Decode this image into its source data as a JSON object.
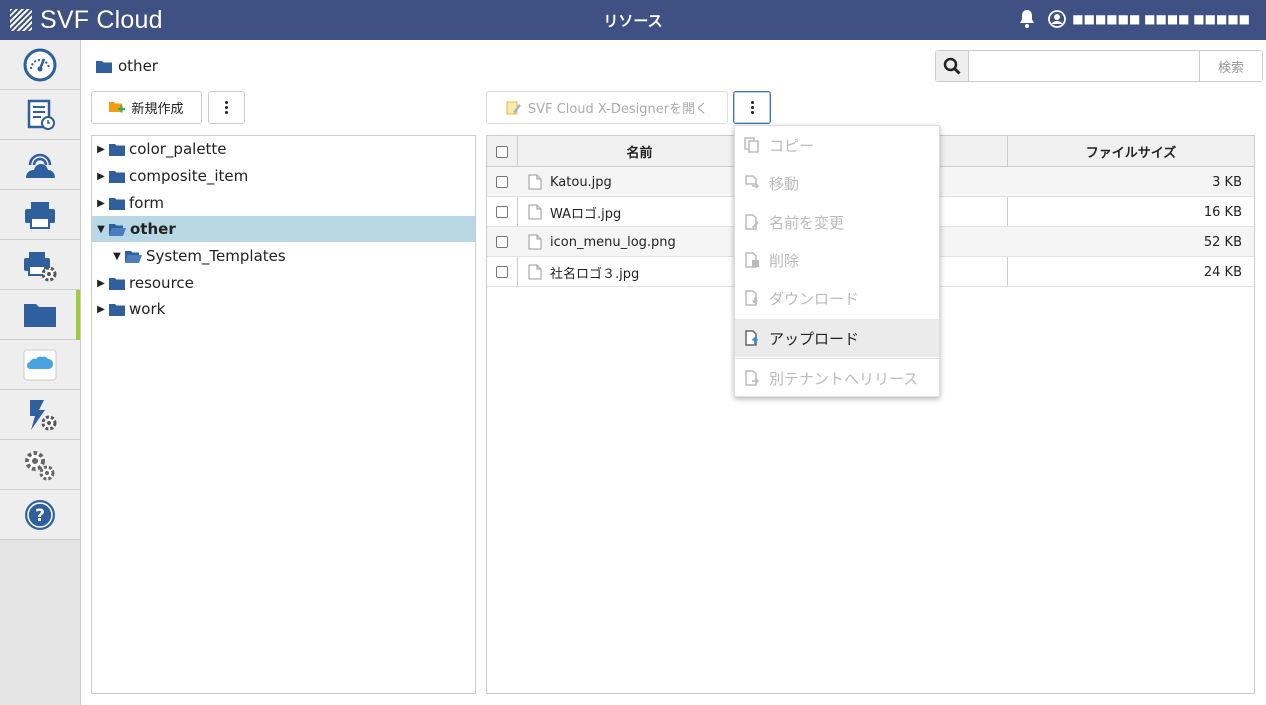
{
  "header": {
    "app_name": "SVF Cloud",
    "title": "リソース",
    "user_name": "■■■■■■ ■■■■ ■■■■■"
  },
  "sidebar": {
    "items": [
      {
        "icon": "dashboard-icon"
      },
      {
        "icon": "schedule-report-icon"
      },
      {
        "icon": "cloud-icon"
      },
      {
        "icon": "printer-icon"
      },
      {
        "icon": "printer-settings-icon"
      },
      {
        "icon": "folder-icon",
        "active": true
      },
      {
        "icon": "salesforce-icon"
      },
      {
        "icon": "action-settings-icon"
      },
      {
        "icon": "gears-icon"
      },
      {
        "icon": "help-icon"
      }
    ]
  },
  "breadcrumb": {
    "current": "other"
  },
  "search": {
    "placeholder": "",
    "button_label": "検索"
  },
  "toolbar": {
    "new_label": "新規作成",
    "designer_label": "SVF Cloud X-Designerを開く"
  },
  "tree": {
    "items": [
      {
        "label": "color_palette",
        "caret": "▶",
        "level": 0
      },
      {
        "label": "composite_item",
        "caret": "▶",
        "level": 0
      },
      {
        "label": "form",
        "caret": "▶",
        "level": 0
      },
      {
        "label": "other",
        "caret": "▼",
        "level": 0,
        "selected": true,
        "open": true
      },
      {
        "label": "System_Templates",
        "caret": "▼",
        "level": 1,
        "open": true
      },
      {
        "label": "resource",
        "caret": "▶",
        "level": 0
      },
      {
        "label": "work",
        "caret": "▶",
        "level": 0
      }
    ]
  },
  "table": {
    "columns": {
      "name": "名前",
      "size": "ファイルサイズ"
    },
    "rows": [
      {
        "name": "Katou.jpg",
        "size": "3 KB"
      },
      {
        "name": "WAロゴ.jpg",
        "size": "16 KB"
      },
      {
        "name": "icon_menu_log.png",
        "size": "52 KB"
      },
      {
        "name": "社名ロゴ３.jpg",
        "size": "24 KB"
      }
    ]
  },
  "menu": {
    "items": [
      {
        "label": "コピー",
        "enabled": false
      },
      {
        "label": "移動",
        "enabled": false
      },
      {
        "label": "名前を変更",
        "enabled": false
      },
      {
        "label": "削除",
        "enabled": false
      },
      {
        "label": "ダウンロード",
        "enabled": false
      },
      {
        "label": "アップロード",
        "enabled": true
      },
      {
        "label": "別テナントへリリース",
        "enabled": false
      }
    ]
  },
  "colors": {
    "header_bg": "#3f5182",
    "accent_active": "#9ccc3c",
    "folder": "#2f5f9d",
    "selected_row": "#b9d8e6"
  }
}
